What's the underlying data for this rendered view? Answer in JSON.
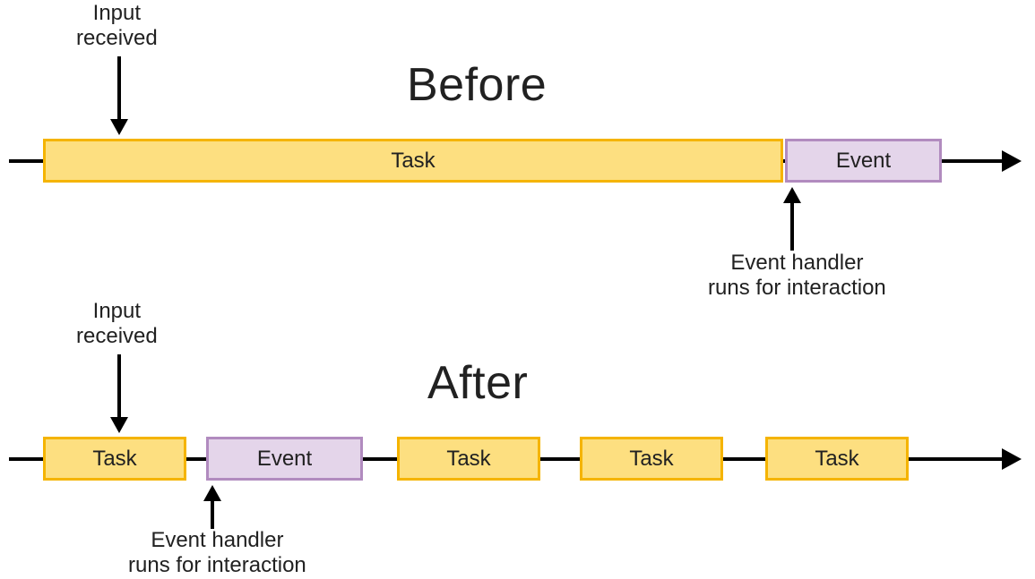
{
  "titles": {
    "before": "Before",
    "after": "After"
  },
  "labels": {
    "task": "Task",
    "event": "Event"
  },
  "annotations": {
    "input_line1": "Input",
    "input_line2": "received",
    "handler_line1": "Event handler",
    "handler_line2": "runs for interaction"
  },
  "colors": {
    "task_fill": "#fddf80",
    "task_border": "#f5b400",
    "event_fill": "#e4d5ea",
    "event_border": "#b18bbf",
    "line": "#000000"
  },
  "chart_data": {
    "type": "diagram-timeline",
    "timelines": [
      {
        "name": "Before",
        "blocks": [
          {
            "kind": "task",
            "label": "Task",
            "span": 5
          },
          {
            "kind": "event",
            "label": "Event",
            "span": 1
          }
        ],
        "input_received_at_block_index": 0,
        "event_handler_at_block_index": 1
      },
      {
        "name": "After",
        "blocks": [
          {
            "kind": "task",
            "label": "Task",
            "span": 1
          },
          {
            "kind": "event",
            "label": "Event",
            "span": 1
          },
          {
            "kind": "task",
            "label": "Task",
            "span": 1
          },
          {
            "kind": "task",
            "label": "Task",
            "span": 1
          },
          {
            "kind": "task",
            "label": "Task",
            "span": 1
          }
        ],
        "input_received_at_block_index": 0,
        "event_handler_at_block_index": 1
      }
    ],
    "description": "Comparison of main-thread scheduling before and after breaking a long task into smaller tasks so the event handler can run sooner after input is received."
  }
}
